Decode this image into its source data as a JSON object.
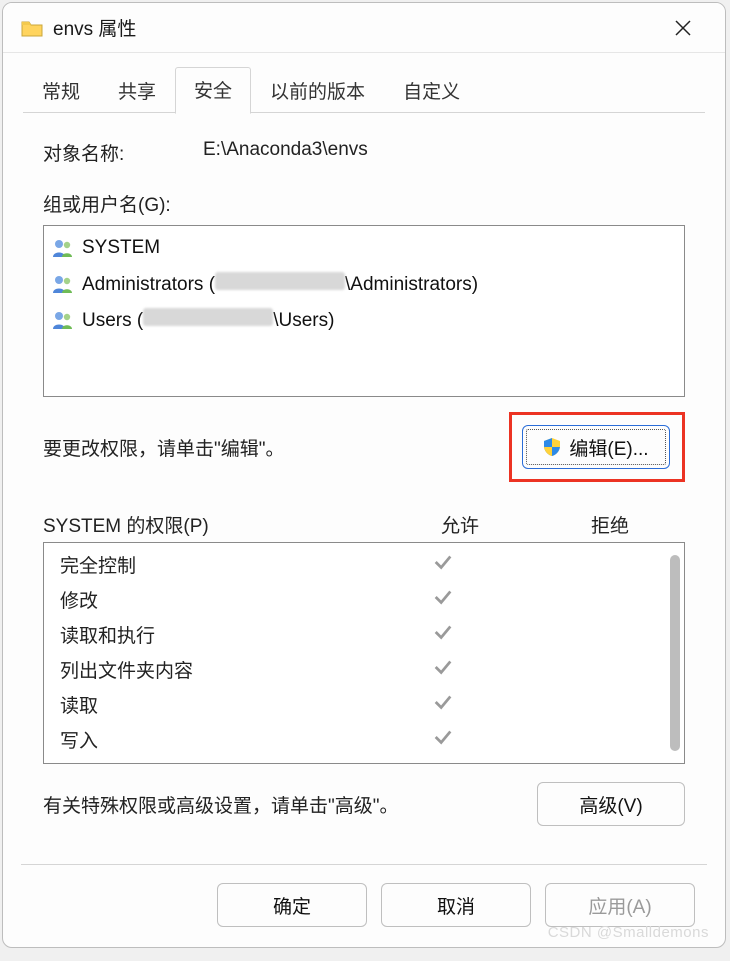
{
  "window": {
    "title": "envs 属性"
  },
  "tabs": {
    "items": [
      {
        "label": "常规",
        "active": false
      },
      {
        "label": "共享",
        "active": false
      },
      {
        "label": "安全",
        "active": true
      },
      {
        "label": "以前的版本",
        "active": false
      },
      {
        "label": "自定义",
        "active": false
      }
    ]
  },
  "object": {
    "label": "对象名称:",
    "value": "E:\\Anaconda3\\envs"
  },
  "groups": {
    "label": "组或用户名(G):",
    "items": [
      {
        "name_pre": "SYSTEM",
        "obscured": null,
        "name_post": ""
      },
      {
        "name_pre": "Administrators (",
        "obscured": true,
        "name_post": "\\Administrators)"
      },
      {
        "name_pre": "Users (",
        "obscured": true,
        "name_post": "\\Users)"
      }
    ]
  },
  "edit": {
    "hint": "要更改权限，请单击\"编辑\"。",
    "button": "编辑(E)..."
  },
  "permissions": {
    "header_name": "SYSTEM 的权限(P)",
    "header_allow": "允许",
    "header_deny": "拒绝",
    "rows": [
      {
        "name": "完全控制",
        "allow": true,
        "deny": false
      },
      {
        "name": "修改",
        "allow": true,
        "deny": false
      },
      {
        "name": "读取和执行",
        "allow": true,
        "deny": false
      },
      {
        "name": "列出文件夹内容",
        "allow": true,
        "deny": false
      },
      {
        "name": "读取",
        "allow": true,
        "deny": false
      },
      {
        "name": "写入",
        "allow": true,
        "deny": false
      }
    ]
  },
  "advanced": {
    "hint": "有关特殊权限或高级设置，请单击\"高级\"。",
    "button": "高级(V)"
  },
  "buttons": {
    "ok": "确定",
    "cancel": "取消",
    "apply": "应用(A)"
  },
  "watermark": "CSDN @Smalldemons"
}
